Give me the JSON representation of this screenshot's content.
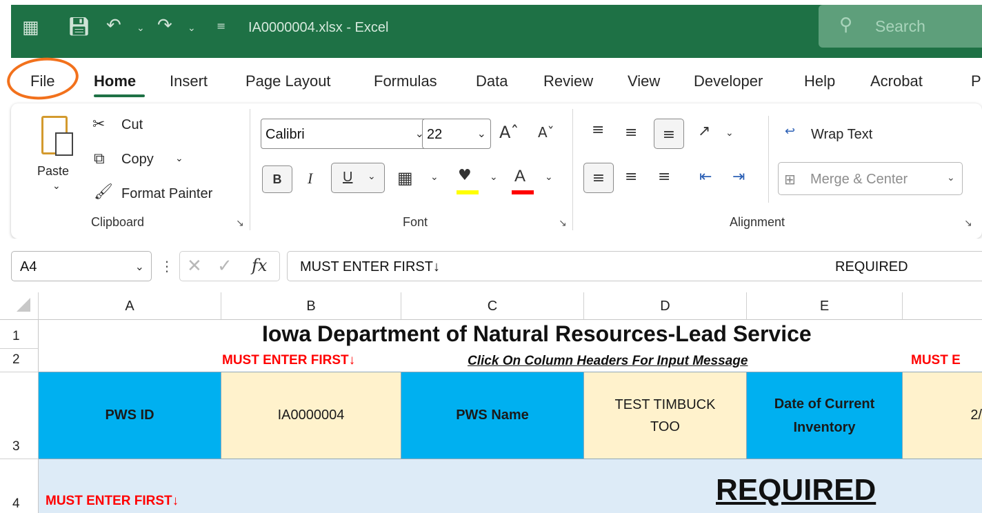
{
  "titlebar": {
    "filename": "IA0000004.xlsx  -  Excel",
    "search_placeholder": "Search"
  },
  "tabs": [
    {
      "label": "File"
    },
    {
      "label": "Home"
    },
    {
      "label": "Insert"
    },
    {
      "label": "Page Layout"
    },
    {
      "label": "Formulas"
    },
    {
      "label": "Data"
    },
    {
      "label": "Review"
    },
    {
      "label": "View"
    },
    {
      "label": "Developer"
    },
    {
      "label": "Help"
    },
    {
      "label": "Acrobat"
    },
    {
      "label": "P"
    }
  ],
  "ribbon": {
    "clipboard": {
      "paste": "Paste",
      "cut": "Cut",
      "copy": "Copy",
      "format_painter": "Format Painter",
      "label": "Clipboard"
    },
    "font": {
      "name": "Calibri",
      "size": "22",
      "bold": "B",
      "italic": "I",
      "underline": "U",
      "font_color_letter": "A",
      "label": "Font",
      "highlight_color": "#ffff00",
      "font_color": "#ff0000"
    },
    "alignment": {
      "wrap_text": "Wrap Text",
      "merge_center": "Merge & Center",
      "label": "Alignment"
    }
  },
  "formula_bar": {
    "name_box": "A4",
    "value": "MUST ENTER FIRST↓",
    "value_right": "REQUIRED"
  },
  "grid": {
    "columns": [
      "A",
      "B",
      "C",
      "D",
      "E"
    ],
    "rows": [
      "1",
      "2",
      "3",
      "4"
    ],
    "title": "Iowa Department of Natural Resources-Lead Service",
    "row2": {
      "must_enter_b": "MUST ENTER FIRST↓",
      "click_headers": "Click On Column Headers For Input Message",
      "must_enter_f": "MUST E"
    },
    "row3": {
      "pws_id_label": "PWS ID",
      "pws_id_value": "IA0000004",
      "pws_name_label": "PWS Name",
      "pws_name_value_1": "TEST TIMBUCK",
      "pws_name_value_2": "TOO",
      "date_label_1": "Date of Current",
      "date_label_2": "Inventory",
      "date_value": "2/"
    },
    "row4": {
      "must_enter_a": "MUST ENTER FIRST↓",
      "required": "REQUIRED"
    }
  },
  "colors": {
    "excel_green": "#1e7145",
    "header_blue": "#00b0f0",
    "cream": "#fff2cc",
    "row4_bg": "#ddebf7",
    "highlight": "#f2711c"
  }
}
